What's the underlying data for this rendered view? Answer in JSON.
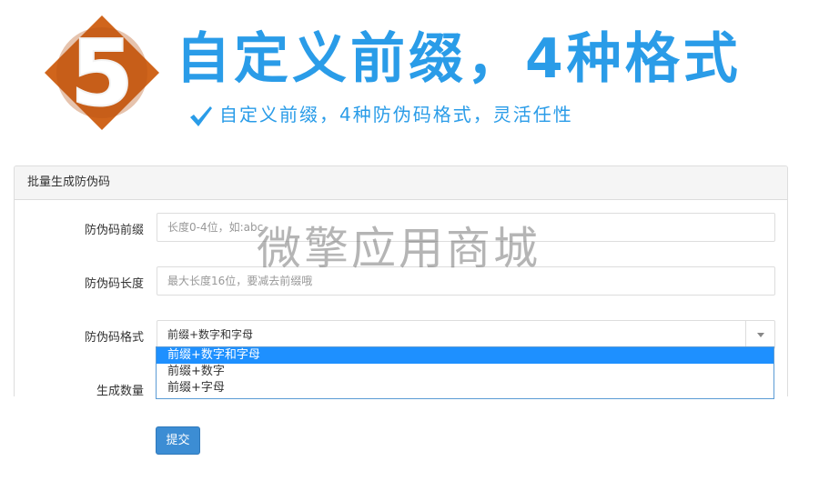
{
  "banner": {
    "badge_number": "5",
    "title": "自定义前缀，4种格式",
    "subtitle": "自定义前缀，4种防伪码格式，灵活任性",
    "check_icon": "checkmark-icon",
    "accent_color": "#2a9ce8",
    "badge_color": "#d0651c"
  },
  "panel": {
    "heading": "批量生成防伪码"
  },
  "form": {
    "prefix": {
      "label": "防伪码前缀",
      "placeholder": "长度0-4位，如:abc"
    },
    "length": {
      "label": "防伪码长度",
      "placeholder": "最大长度16位，要减去前缀哦"
    },
    "format": {
      "label": "防伪码格式",
      "selected": "前缀+数字和字母",
      "options": [
        "前缀+数字和字母",
        "前缀+数字",
        "前缀+字母"
      ]
    },
    "quantity": {
      "label": "生成数量"
    },
    "submit_label": "提交"
  },
  "watermark": "微擎应用商城"
}
